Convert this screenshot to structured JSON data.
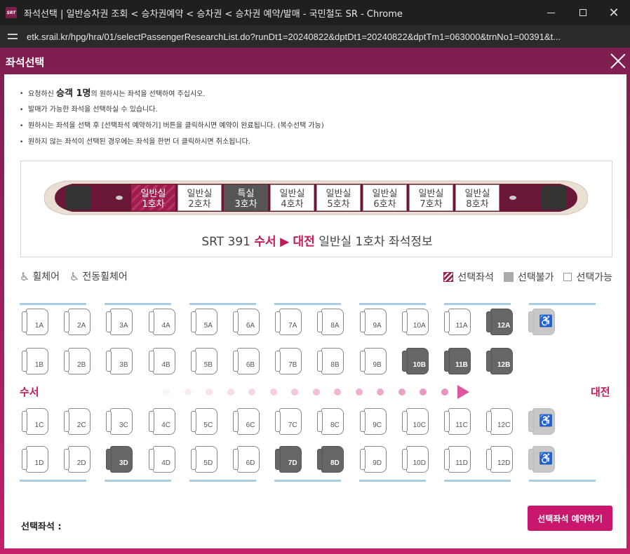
{
  "window": {
    "title": "좌석선택 | 일반승차권 조회 < 승차권예약 < 승차권 < 승차권 예약/발매 - 국민철도 SR - Chrome",
    "favicon_text": "SRT",
    "url": "etk.srail.kr/hpg/hra/01/selectPassengerResearchList.do?runDt1=20240822&dptDt1=20240822&dptTm1=063000&trnNo1=00391&t..."
  },
  "popup": {
    "title": "좌석선택"
  },
  "notices": {
    "n1_pre": "요청하신",
    "n1_strong": "승객 1명",
    "n1_post": "의 원하시는 좌석을 선택하여 주십시오.",
    "n2": "발매가 가능한 좌석을 선택하실 수 있습니다.",
    "n3": "원하시는 좌석을 선택 후 [선택좌석 예약하기] 버튼을 클릭하시면 예약이 완료됩니다. (복수선택 가능)",
    "n4": "원하지 않는 좌석이 선택된 경우에는 좌석을 한번 더 클릭하시면 취소됩니다."
  },
  "cars": [
    {
      "l1": "일반실",
      "l2": "1호차",
      "state": "selected"
    },
    {
      "l1": "일반실",
      "l2": "2호차",
      "state": "normal"
    },
    {
      "l1": "특실",
      "l2": "3호차",
      "state": "first-class"
    },
    {
      "l1": "일반실",
      "l2": "4호차",
      "state": "normal"
    },
    {
      "l1": "일반실",
      "l2": "5호차",
      "state": "normal"
    },
    {
      "l1": "일반실",
      "l2": "6호차",
      "state": "normal"
    },
    {
      "l1": "일반실",
      "l2": "7호차",
      "state": "normal"
    },
    {
      "l1": "일반실",
      "l2": "8호차",
      "state": "normal"
    }
  ],
  "train_info": {
    "number": "SRT 391",
    "from": "수서",
    "arrow": "▶",
    "to": "대전",
    "suffix": "일반실 1호차 좌석정보"
  },
  "legend": {
    "wheelchair": "휠체어",
    "electric_wheelchair": "전동휠체어",
    "selected": "선택좌석",
    "unavailable": "선택불가",
    "available": "선택가능",
    "wheelchair_glyph": "♿"
  },
  "direction": {
    "from": "수서",
    "to": "대전"
  },
  "seats": {
    "rowA": [
      {
        "label": "1A",
        "state": "available"
      },
      {
        "label": "2A",
        "state": "available"
      },
      {
        "label": "3A",
        "state": "available"
      },
      {
        "label": "4A",
        "state": "available"
      },
      {
        "label": "5A",
        "state": "available"
      },
      {
        "label": "6A",
        "state": "available"
      },
      {
        "label": "7A",
        "state": "available"
      },
      {
        "label": "8A",
        "state": "available"
      },
      {
        "label": "9A",
        "state": "available"
      },
      {
        "label": "10A",
        "state": "available"
      },
      {
        "label": "11A",
        "state": "available"
      },
      {
        "label": "12A",
        "state": "booked"
      },
      {
        "label": "♿",
        "state": "wheel"
      }
    ],
    "rowB": [
      {
        "label": "1B",
        "state": "available"
      },
      {
        "label": "2B",
        "state": "available"
      },
      {
        "label": "3B",
        "state": "available"
      },
      {
        "label": "4B",
        "state": "available"
      },
      {
        "label": "5B",
        "state": "available"
      },
      {
        "label": "6B",
        "state": "available"
      },
      {
        "label": "7B",
        "state": "available"
      },
      {
        "label": "8B",
        "state": "available"
      },
      {
        "label": "9B",
        "state": "available"
      },
      {
        "label": "10B",
        "state": "booked"
      },
      {
        "label": "11B",
        "state": "booked"
      },
      {
        "label": "12B",
        "state": "booked"
      }
    ],
    "rowC": [
      {
        "label": "1C",
        "state": "available"
      },
      {
        "label": "2C",
        "state": "available"
      },
      {
        "label": "3C",
        "state": "available"
      },
      {
        "label": "4C",
        "state": "available"
      },
      {
        "label": "5C",
        "state": "available"
      },
      {
        "label": "6C",
        "state": "available"
      },
      {
        "label": "7C",
        "state": "available"
      },
      {
        "label": "8C",
        "state": "available"
      },
      {
        "label": "9C",
        "state": "available"
      },
      {
        "label": "10C",
        "state": "available"
      },
      {
        "label": "11C",
        "state": "available"
      },
      {
        "label": "12C",
        "state": "available"
      },
      {
        "label": "♿",
        "state": "wheel"
      }
    ],
    "rowD": [
      {
        "label": "1D",
        "state": "available"
      },
      {
        "label": "2D",
        "state": "available"
      },
      {
        "label": "3D",
        "state": "booked"
      },
      {
        "label": "4D",
        "state": "available"
      },
      {
        "label": "5D",
        "state": "available"
      },
      {
        "label": "6D",
        "state": "available"
      },
      {
        "label": "7D",
        "state": "booked"
      },
      {
        "label": "8D",
        "state": "booked"
      },
      {
        "label": "9D",
        "state": "available"
      },
      {
        "label": "10D",
        "state": "available"
      },
      {
        "label": "11D",
        "state": "available"
      },
      {
        "label": "12D",
        "state": "available"
      },
      {
        "label": "♿",
        "state": "wheel"
      }
    ]
  },
  "footer": {
    "selected_label": "선택좌석 :",
    "reserve_button": "선택좌석 예약하기"
  },
  "colors": {
    "brand": "#7d1f4f",
    "accent": "#c8176d",
    "window_bar": "#a9cee0"
  }
}
